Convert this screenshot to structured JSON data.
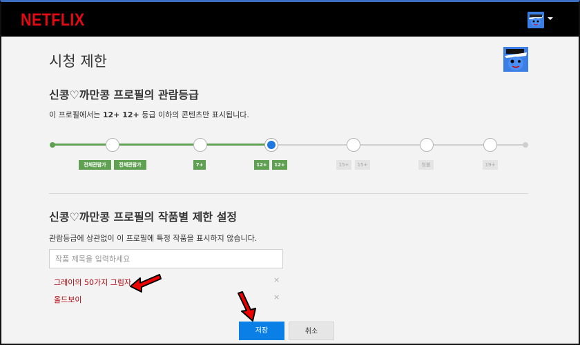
{
  "header": {
    "logo": "NETFLIX"
  },
  "page": {
    "title": "시청 제한"
  },
  "maturity": {
    "title": "신콩♡까만콩 프로필의 관람등급",
    "desc_prefix": "이 프로필에서는 ",
    "desc_bold": "12+ 12+",
    "desc_suffix": " 등급 이하의 콘텐츠만 표시됩니다.",
    "badges": [
      "전체관람가",
      "전체관람가",
      "7+",
      "12+",
      "12+",
      "15+",
      "15+",
      "청불",
      "19+"
    ],
    "selected_level": "12+"
  },
  "title_restrictions": {
    "title": "신콩♡까만콩 프로필의 작품별 제한 설정",
    "desc": "관람등급에 상관없이 이 프로필에 특정 작품을 표시하지 않습니다.",
    "search_placeholder": "작품 제목을 입력하세요",
    "items": [
      "그레이의 50가지 그림자",
      "올드보이"
    ],
    "remove_symbol": "×"
  },
  "buttons": {
    "save": "저장",
    "cancel": "취소"
  },
  "colors": {
    "brand": "#e50914",
    "accent": "#0a80e6",
    "rating_green": "#5fa053",
    "restricted_text": "#b1060f"
  }
}
